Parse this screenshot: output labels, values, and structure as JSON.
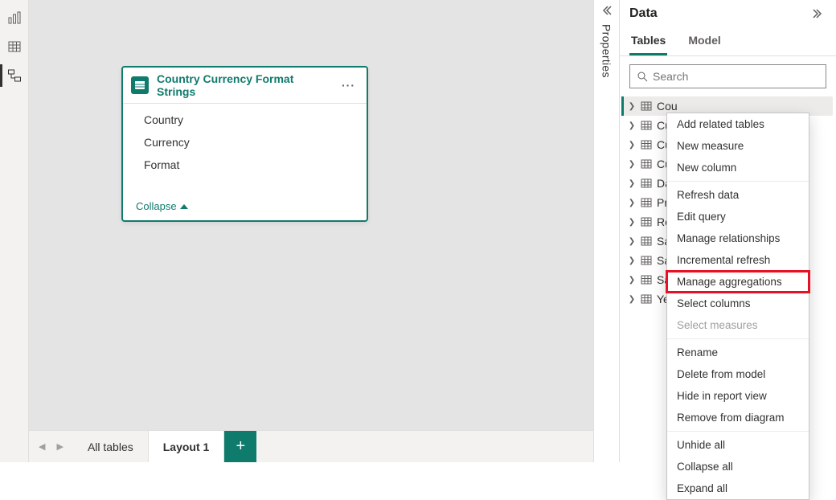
{
  "rail": {
    "report_view": "report-view",
    "data_view": "data-view",
    "model_view": "model-view"
  },
  "card": {
    "title": "Country Currency Format Strings",
    "fields": [
      "Country",
      "Currency",
      "Format"
    ],
    "collapse_label": "Collapse"
  },
  "tabs": {
    "all_tables": "All tables",
    "layout1": "Layout 1"
  },
  "properties_strip": {
    "label": "Properties"
  },
  "data_pane": {
    "title": "Data",
    "tab_tables": "Tables",
    "tab_model": "Model",
    "search_placeholder": "Search",
    "tables": [
      "Cou",
      "Cur",
      "Cur",
      "Cus",
      "Dat",
      "Pro",
      "Res",
      "Sal",
      "Sal",
      "Sal",
      "Yea"
    ]
  },
  "context_menu": {
    "items": [
      "Add related tables",
      "New measure",
      "New column",
      "Refresh data",
      "Edit query",
      "Manage relationships",
      "Incremental refresh",
      "Manage aggregations",
      "Select columns",
      "Select measures",
      "Rename",
      "Delete from model",
      "Hide in report view",
      "Remove from diagram",
      "Unhide all",
      "Collapse all",
      "Expand all"
    ],
    "disabled_index": 9,
    "highlight_index": 7
  }
}
